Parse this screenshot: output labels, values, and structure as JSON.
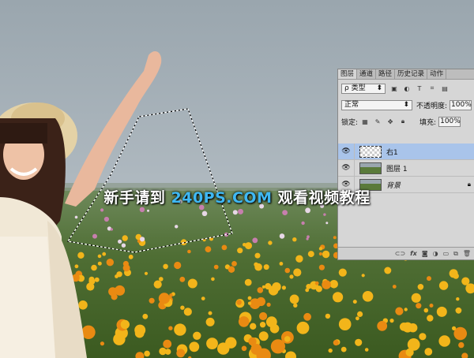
{
  "panel": {
    "tabs": [
      "图层",
      "通道",
      "路径",
      "历史记录",
      "动作"
    ],
    "filter_label": "ρ 类型",
    "blend_mode": "正常",
    "opacity_label": "不透明度:",
    "opacity_value": "100%",
    "lock_label": "锁定:",
    "fill_label": "填充:",
    "fill_value": "100%",
    "layers": [
      {
        "name": "右1",
        "selected": true
      },
      {
        "name": "图层 1",
        "selected": false
      },
      {
        "name": "背景",
        "selected": false
      }
    ],
    "footer_icons": [
      "link-icon",
      "fx-icon",
      "mask-icon",
      "adjustment-icon",
      "group-icon",
      "new-layer-icon",
      "trash-icon"
    ]
  },
  "watermark": {
    "before": "新手请到 ",
    "site": "240PS.COM",
    "after": " 观看视频教程"
  }
}
